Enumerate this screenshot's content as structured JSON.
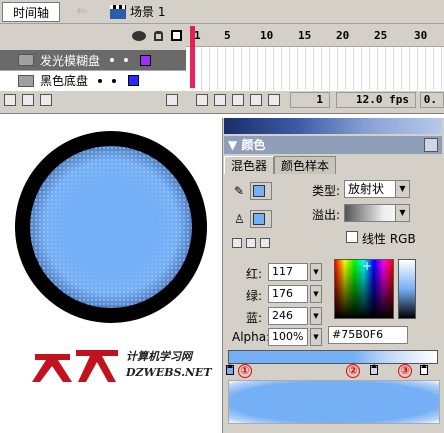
{
  "timeline": {
    "tab_label": "时间轴",
    "scene_label": "场景 1",
    "ruler": [
      "1",
      "5",
      "10",
      "15",
      "20",
      "25",
      "30"
    ],
    "layers": [
      {
        "name": "发光模糊盘",
        "color": "#9b30ff"
      },
      {
        "name": "黑色底盘",
        "color": "#2a2aff"
      }
    ],
    "current_frame": "1",
    "fps": "12.0 fps",
    "elapsed": "0."
  },
  "color_panel": {
    "title": "颜色",
    "tabs": [
      "混色器",
      "颜色样本"
    ],
    "type_label": "类型:",
    "type_value": "放射状",
    "overflow_label": "溢出:",
    "linear_rgb_label": "线性 RGB",
    "red_label": "红:",
    "red_value": "117",
    "green_label": "绿:",
    "green_value": "176",
    "blue_label": "蓝:",
    "blue_value": "246",
    "alpha_label": "Alpha:",
    "alpha_value": "100%",
    "hex_value": "#75B0F6",
    "markers": [
      "①",
      "②",
      "③"
    ],
    "colors": {
      "fill": "#75B0F6",
      "accent": "#8f9fb9"
    }
  },
  "watermark": {
    "cn": "计算机学习网",
    "en": "DZWEBS.NET",
    "brand": "大众"
  }
}
